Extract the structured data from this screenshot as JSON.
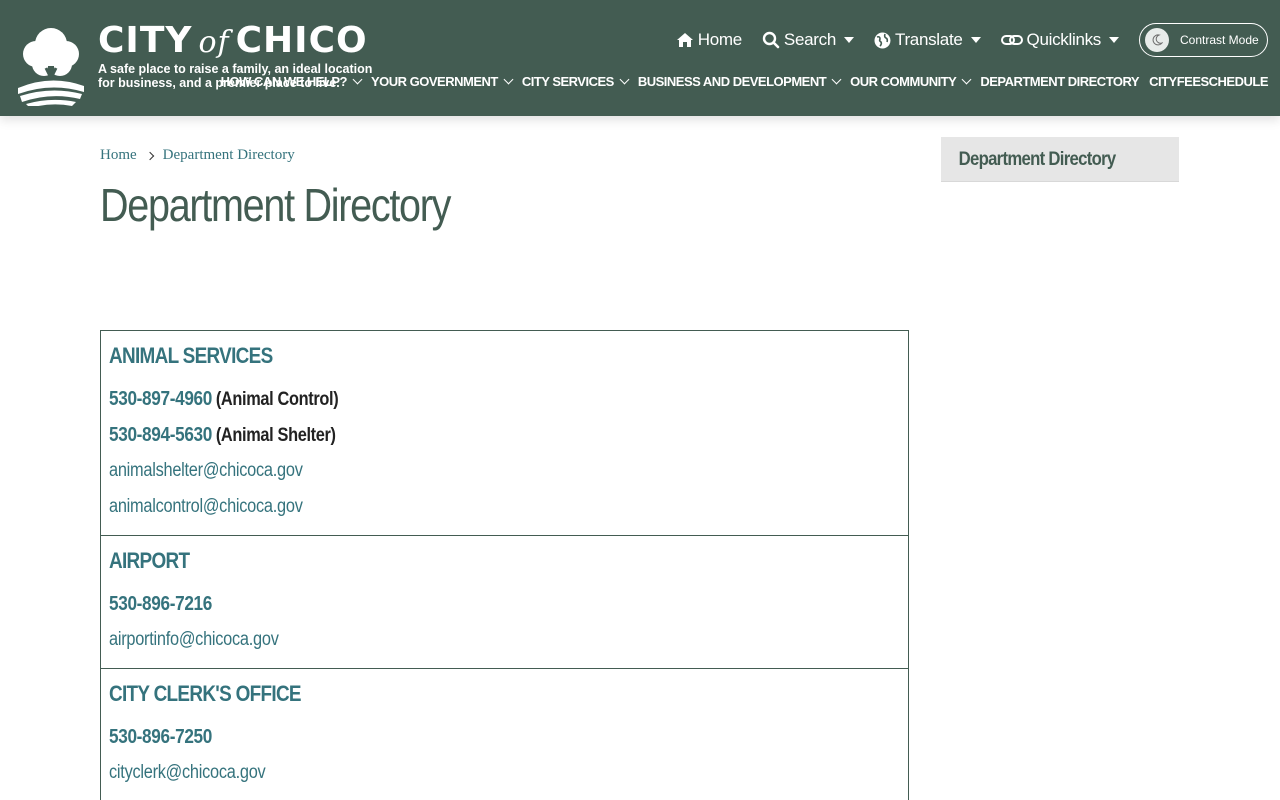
{
  "header": {
    "logo": {
      "title_left": "CITY",
      "title_of": "of",
      "title_right": "CHICO",
      "tagline_line1": "A safe place to raise a family, an ideal location",
      "tagline_line2": "for business, and a premier place to live."
    },
    "utility_nav": {
      "home": "Home",
      "search": "Search",
      "translate": "Translate",
      "quicklinks": "Quicklinks",
      "contrast_mode": "Contrast Mode"
    },
    "main_nav": [
      {
        "label": "HOW CAN WE HELP?",
        "has_dropdown": true
      },
      {
        "label": "YOUR GOVERNMENT",
        "has_dropdown": true
      },
      {
        "label": "CITY SERVICES",
        "has_dropdown": true
      },
      {
        "label": "BUSINESS AND DEVELOPMENT",
        "has_dropdown": true
      },
      {
        "label": "OUR COMMUNITY",
        "has_dropdown": true
      },
      {
        "label": "DEPARTMENT DIRECTORY",
        "has_dropdown": false
      },
      {
        "label": "CITYFEESCHEDULE",
        "has_dropdown": false
      }
    ]
  },
  "breadcrumb": {
    "home": "Home",
    "current": "Department Directory"
  },
  "page_title": "Department Directory",
  "sidebar": {
    "active_item": "Department Directory"
  },
  "departments": [
    {
      "name": "ANIMAL SERVICES",
      "phones": [
        {
          "number": "530-897-4960",
          "note": "(Animal Control)"
        },
        {
          "number": "530-894-5630",
          "note": "(Animal Shelter)"
        }
      ],
      "emails": [
        "animalshelter@chicoca.gov",
        "animalcontrol@chicoca.gov"
      ]
    },
    {
      "name": "AIRPORT",
      "phones": [
        {
          "number": "530-896-7216",
          "note": ""
        }
      ],
      "emails": [
        "airportinfo@chicoca.gov"
      ]
    },
    {
      "name": "CITY CLERK'S OFFICE",
      "phones": [
        {
          "number": "530-896-7250",
          "note": ""
        }
      ],
      "emails": [
        "cityclerk@chicoca.gov"
      ]
    }
  ],
  "colors": {
    "header_bg": "#435c52",
    "link": "#35737d",
    "title": "#435c52",
    "sidebar_bg": "#e6e6e6"
  }
}
